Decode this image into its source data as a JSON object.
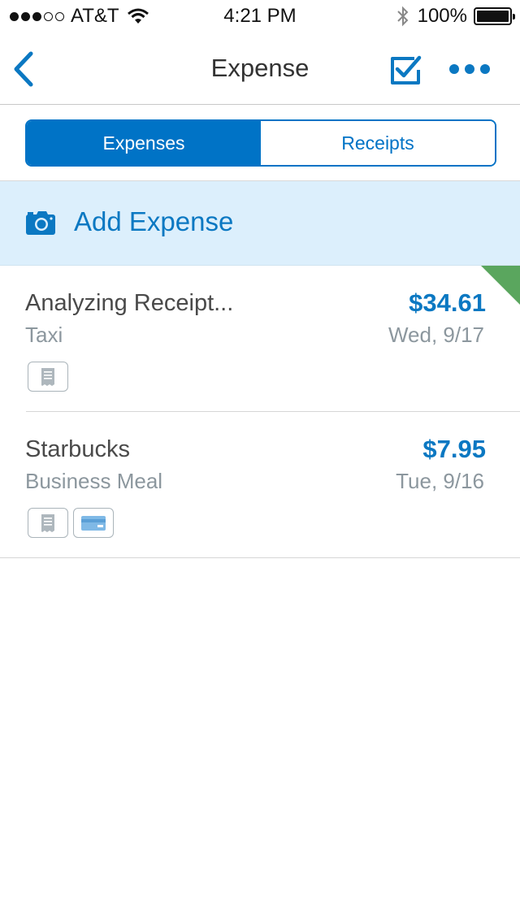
{
  "status_bar": {
    "carrier": "AT&T",
    "time": "4:21 PM",
    "battery_percent": "100%",
    "signal_strength": 3,
    "signal_max": 5
  },
  "nav": {
    "title": "Expense",
    "back_icon": "chevron-left-icon",
    "approve_icon": "checkbox-icon",
    "more_icon": "more-icon"
  },
  "tabs": [
    {
      "label": "Expenses",
      "active": true
    },
    {
      "label": "Receipts",
      "active": false
    }
  ],
  "add_expense": {
    "label": "Add Expense",
    "icon": "camera-icon"
  },
  "expenses": [
    {
      "merchant": "Analyzing Receipt...",
      "category": "Taxi",
      "amount": "$34.61",
      "date": "Wed, 9/17",
      "icons": [
        "receipt-icon"
      ],
      "flag_color": "#5aa65e"
    },
    {
      "merchant": "Starbucks",
      "category": "Business Meal",
      "amount": "$7.95",
      "date": "Tue, 9/16",
      "icons": [
        "receipt-icon",
        "credit-card-icon"
      ]
    }
  ],
  "colors": {
    "accent": "#0073c6",
    "amount": "#0b78c2",
    "add_expense_bg": "#dceffc",
    "flag": "#5aa65e"
  }
}
